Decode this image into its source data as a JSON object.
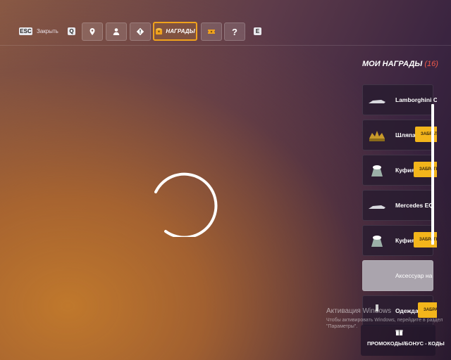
{
  "topbar": {
    "esc_key": "ESC",
    "esc_label": "Закрыть",
    "q_key": "Q",
    "e_key": "E",
    "rewards_label": "НАГРАДЫ",
    "help_label": "?",
    "buttons": [
      "map-pin-icon",
      "person-icon",
      "alert-icon",
      "rewards-chest-icon",
      "ticket-icon",
      "help-icon"
    ]
  },
  "loading": {
    "state": "spinner"
  },
  "rewards_panel": {
    "title": "МОИ НАГРАДЫ",
    "count": "(16)",
    "claim_label": "ЗАБРАТЬ",
    "items": [
      {
        "name": "Lamborghini C",
        "icon": "car-icon"
      },
      {
        "name": "Шляпа",
        "icon": "hat-icon"
      },
      {
        "name": "Куфия",
        "icon": "keffiyeh-icon"
      },
      {
        "name": "Mercedes EQ",
        "icon": "car-icon"
      },
      {
        "name": "Куфия",
        "icon": "keffiyeh-icon"
      },
      {
        "name": "Аксессуар на",
        "icon": "accessory-icon"
      },
      {
        "name": "Одежда",
        "icon": "clothes-icon"
      }
    ],
    "promo_label": "ПРОМОКОДЫ/БОНУС - КОДЫ"
  },
  "watermark": {
    "title": "Активация Windows",
    "subtitle": "Чтобы активировать Windows, перейдите в раздел \"Параметры\"."
  },
  "colors": {
    "accent": "#f0a21c",
    "claim": "#f3b51b",
    "count": "#f05a4a"
  }
}
